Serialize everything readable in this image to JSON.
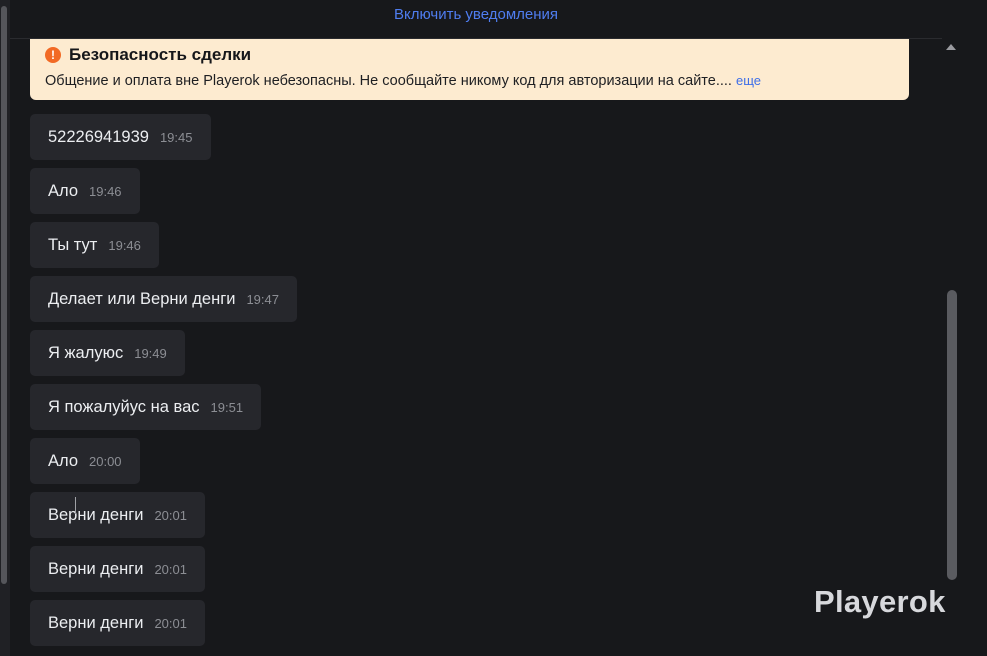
{
  "notify": {
    "label": "Включить уведомления"
  },
  "warning": {
    "title": "Безопасность сделки",
    "text": "Общение и оплата вне Playerok небезопасны. Не сообщайте никому код для авторизации на сайте....",
    "more": "еще",
    "icon": "!"
  },
  "messages": [
    {
      "text": "52226941939",
      "time": "19:45"
    },
    {
      "text": "Ало",
      "time": "19:46"
    },
    {
      "text": "Ты тут",
      "time": "19:46"
    },
    {
      "text": "Делает или Верни денги",
      "time": "19:47"
    },
    {
      "text": "Я жалуюс",
      "time": "19:49"
    },
    {
      "text": "Я пожалуйус на вас",
      "time": "19:51"
    },
    {
      "text": "Ало",
      "time": "20:00"
    },
    {
      "text": "Верни денги",
      "time": "20:01"
    },
    {
      "text": "Верни денги",
      "time": "20:01"
    },
    {
      "text": "Верни денги",
      "time": "20:01"
    }
  ],
  "brand": {
    "logo": "Playerok"
  },
  "colors": {
    "accent_link": "#4f7df0",
    "warning_bg": "#fdebd0",
    "warning_icon": "#f26a25",
    "bubble_bg": "#26272c",
    "page_bg": "#17181b"
  }
}
